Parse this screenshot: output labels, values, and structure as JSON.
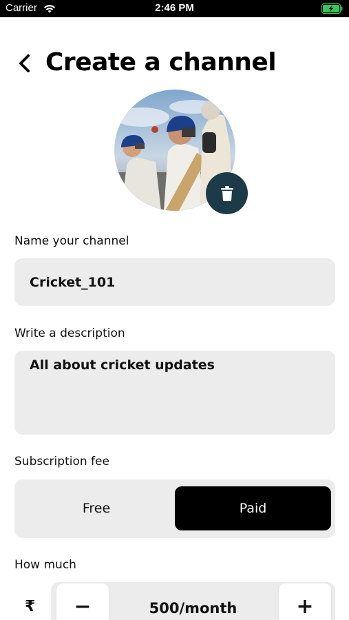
{
  "status_bar": {
    "carrier": "Carrier",
    "time": "2:46 PM",
    "battery_color": "#34c759"
  },
  "header": {
    "back_icon": "chevron-left-icon",
    "title": "Create a channel"
  },
  "avatar": {
    "delete_icon": "trash-icon",
    "delete_button_color": "#1c3a47"
  },
  "form": {
    "name_label": "Name your channel",
    "name_value": "Cricket_101",
    "description_label": "Write a description",
    "description_value": "All about cricket updates",
    "fee_label": "Subscription fee",
    "fee_options": [
      "Free",
      "Paid"
    ],
    "fee_selected": "Paid",
    "amount_label": "How much",
    "currency_symbol": "₹",
    "minus_label": "−",
    "plus_label": "+",
    "amount_value": "500/month"
  }
}
